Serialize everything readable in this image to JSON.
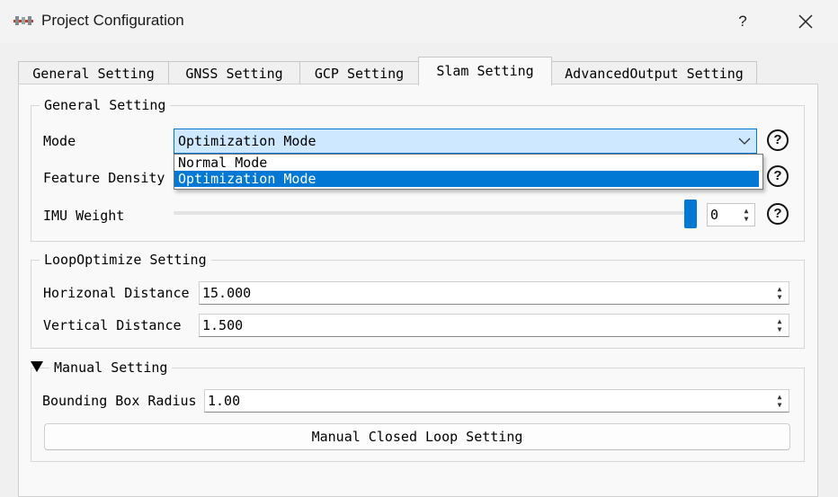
{
  "window": {
    "title": "Project Configuration",
    "help_label": "?"
  },
  "tabs": [
    {
      "label": "General Setting"
    },
    {
      "label": "GNSS Setting"
    },
    {
      "label": "GCP Setting"
    },
    {
      "label": "Slam Setting",
      "active": true
    },
    {
      "label": "AdvancedOutput Setting"
    }
  ],
  "general_group": {
    "title": "General Setting",
    "mode_label": "Mode",
    "mode_value": "Optimization Mode",
    "mode_options": [
      "Normal Mode",
      "Optimization Mode"
    ],
    "feature_density_label": "Feature Density",
    "imu_weight_label": "IMU Weight",
    "imu_weight_value": "0",
    "imu_weight_slider_fraction": 1.0,
    "help_icon_glyph": "?"
  },
  "loop_group": {
    "title": "LoopOptimize Setting",
    "horizontal_label": "Horizonal Distance",
    "horizontal_value": "15.000",
    "vertical_label": "Vertical Distance",
    "vertical_value": "1.500"
  },
  "manual_group": {
    "title": "Manual Setting",
    "radius_label": "Bounding Box Radius",
    "radius_value": "1.00",
    "button_label": "Manual Closed Loop Setting"
  },
  "colors": {
    "accent": "#0078d4",
    "combo_bg": "#cde8ff"
  }
}
